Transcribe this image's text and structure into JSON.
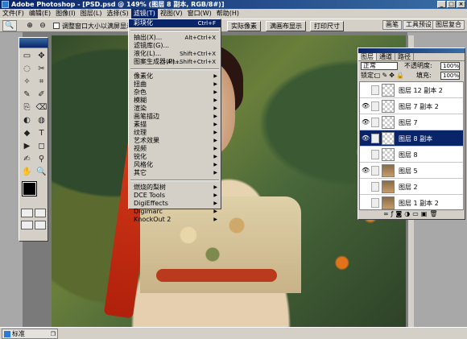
{
  "window": {
    "title": "Adobe Photoshop - [PSD.psd @ 149% (图层 8 副本, RGB/8#)]",
    "minimize": "_",
    "maximize": "□",
    "close": "×"
  },
  "menubar": {
    "items": [
      "文件(F)",
      "编辑(E)",
      "图像(I)",
      "图层(L)",
      "选择(S)",
      "滤镜(T)",
      "视图(V)",
      "窗口(W)",
      "帮助(H)"
    ]
  },
  "options": {
    "checkbox_label": "调整窗口大小以满屏显示",
    "buttons": [
      "实际像素",
      "满画布显示",
      "打印尺寸"
    ],
    "well_tabs": [
      "画笔",
      "工具预设",
      "图层复合"
    ]
  },
  "filter_menu": {
    "top": [
      {
        "label": "彩块化",
        "shortcut": "Ctrl+F"
      },
      {
        "label": "抽出(X)...",
        "shortcut": "Alt+Ctrl+X"
      },
      {
        "label": "滤镜库(G)...",
        "shortcut": ""
      },
      {
        "label": "液化(L)...",
        "shortcut": "Shift+Ctrl+X"
      },
      {
        "label": "图案生成器(P)...",
        "shortcut": "Alt+Shift+Ctrl+X"
      }
    ],
    "submenus": [
      "像素化",
      "扭曲",
      "杂色",
      "模糊",
      "渲染",
      "画笔描边",
      "素描",
      "纹理",
      "艺术效果",
      "视频",
      "锐化",
      "风格化",
      "其它"
    ],
    "plugins": [
      "燃烧的梨树",
      "DCE Tools",
      "DigiEffects",
      "Digimarc",
      "KnockOut 2"
    ]
  },
  "layers_panel": {
    "tabs": [
      "图层",
      "通道",
      "路径"
    ],
    "blend_mode": "正常",
    "opacity_label": "不透明度:",
    "opacity": "100%",
    "lock_label": "锁定:",
    "fill_label": "填充:",
    "fill": "100%",
    "layers": [
      {
        "name": "图层 12 副本 2",
        "visible": false,
        "thumb": "transparent",
        "selected": false
      },
      {
        "name": "图层 7 副本 2",
        "visible": true,
        "thumb": "transparent",
        "selected": false
      },
      {
        "name": "图层 7",
        "visible": true,
        "thumb": "transparent",
        "selected": false
      },
      {
        "name": "图层 8 副本",
        "visible": true,
        "thumb": "transparent",
        "selected": true
      },
      {
        "name": "图层 8",
        "visible": false,
        "thumb": "transparent",
        "selected": false
      },
      {
        "name": "图层 5",
        "visible": true,
        "thumb": "photo",
        "selected": false
      },
      {
        "name": "图层 2",
        "visible": false,
        "thumb": "photo",
        "selected": false
      },
      {
        "name": "图层 1 副本 2",
        "visible": false,
        "thumb": "photo",
        "selected": false
      }
    ]
  },
  "toolbox": {
    "tools": [
      "▭",
      "✥",
      "◌",
      "✂",
      "✧",
      "⌗",
      "✎",
      "✐",
      "⎘",
      "⌫",
      "◐",
      "◍",
      "◆",
      "T",
      "▶",
      "◻",
      "✍",
      "⚲",
      "✋",
      "🔍"
    ]
  },
  "status": {
    "doc_label": "标准"
  }
}
